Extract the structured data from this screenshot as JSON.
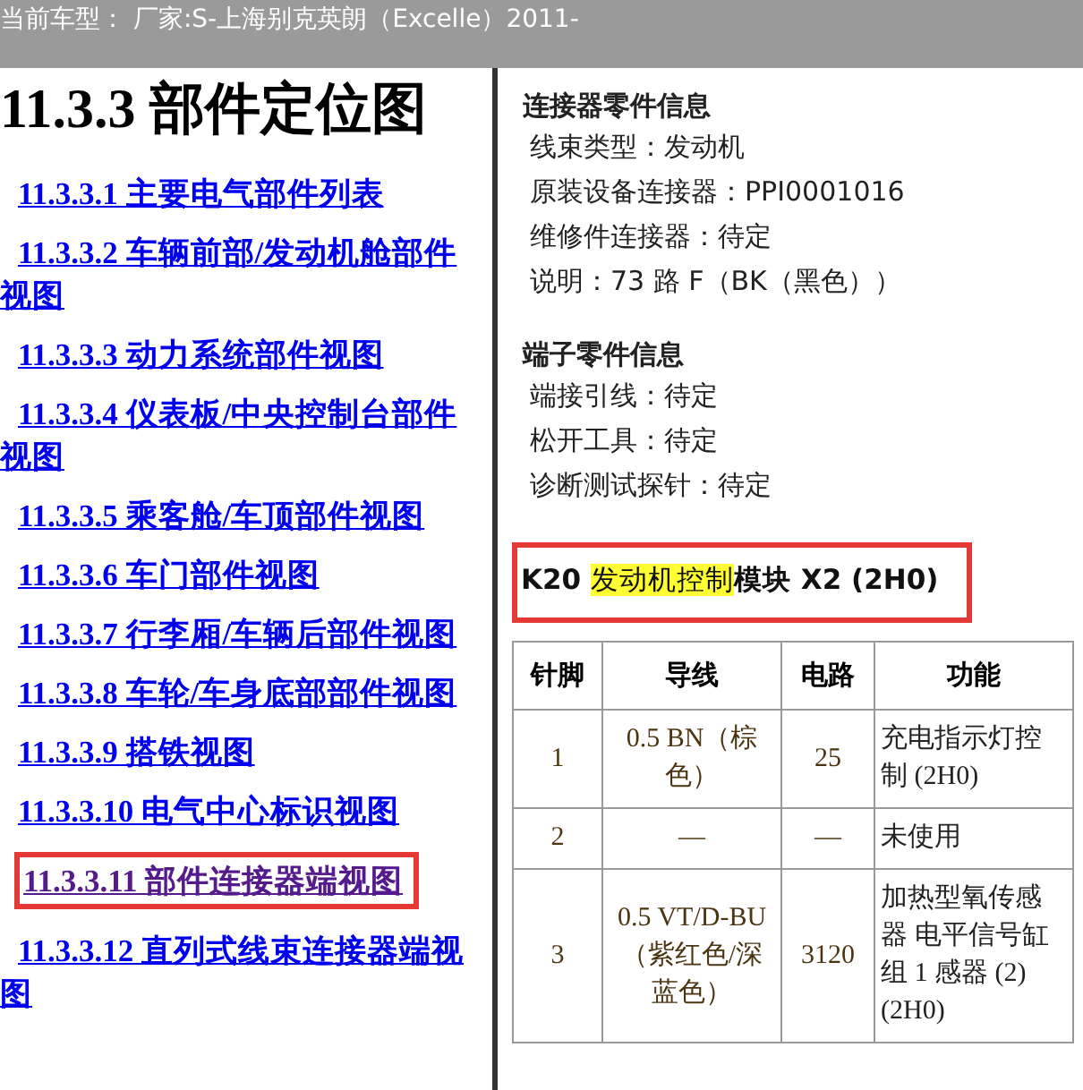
{
  "header": {
    "text": "当前车型： 厂家:S-上海别克英朗（Excelle）2011-"
  },
  "toc": {
    "title": "11.3.3 部件定位图",
    "links": [
      {
        "label": "11.3.3.1 主要电气部件列表",
        "visited": false,
        "boxed": false
      },
      {
        "label": "11.3.3.2 车辆前部/发动机舱部件视图",
        "visited": false,
        "boxed": false
      },
      {
        "label": "11.3.3.3 动力系统部件视图",
        "visited": false,
        "boxed": false
      },
      {
        "label": "11.3.3.4 仪表板/中央控制台部件视图",
        "visited": false,
        "boxed": false
      },
      {
        "label": "11.3.3.5 乘客舱/车顶部件视图",
        "visited": false,
        "boxed": false
      },
      {
        "label": "11.3.3.6 车门部件视图",
        "visited": false,
        "boxed": false
      },
      {
        "label": "11.3.3.7 行李厢/车辆后部件视图",
        "visited": false,
        "boxed": false
      },
      {
        "label": "11.3.3.8 车轮/车身底部部件视图",
        "visited": false,
        "boxed": false
      },
      {
        "label": "11.3.3.9 搭铁视图",
        "visited": false,
        "boxed": false
      },
      {
        "label": "11.3.3.10 电气中心标识视图",
        "visited": false,
        "boxed": false
      },
      {
        "label": "11.3.3.11 部件连接器端视图",
        "visited": true,
        "boxed": true
      },
      {
        "label": "11.3.3.12 直列式线束连接器端视图",
        "visited": false,
        "boxed": false
      }
    ]
  },
  "sections": [
    {
      "title": "连接器零件信息",
      "lines": [
        "线束类型：发动机",
        "原装设备连接器：PPI0001016",
        "维修件连接器：待定",
        "说明：73 路 F（BK（黑色））"
      ]
    },
    {
      "title": "端子零件信息",
      "lines": [
        "端接引线：待定",
        "松开工具：待定",
        "诊断测试探针：待定"
      ]
    }
  ],
  "connector_title": {
    "boxed": true,
    "parts": [
      {
        "text": "K20 ",
        "highlighted": false
      },
      {
        "text": "发动机控制",
        "highlighted": true
      },
      {
        "text": "模块 X2 (2H0)",
        "highlighted": false
      }
    ]
  },
  "table": {
    "columns": [
      "针脚",
      "导线",
      "电路",
      "功能"
    ],
    "rows": [
      [
        "1",
        "0.5 BN（棕色）",
        "25",
        "充电指示灯控制 (2H0)"
      ],
      [
        "2",
        "—",
        "—",
        "未使用"
      ],
      [
        "3",
        "0.5 VT/D-BU（紫红色/深蓝色）",
        "3120",
        "加热型氧传感器 电平信号缸组 1 感器 (2) (2H0)"
      ]
    ]
  }
}
